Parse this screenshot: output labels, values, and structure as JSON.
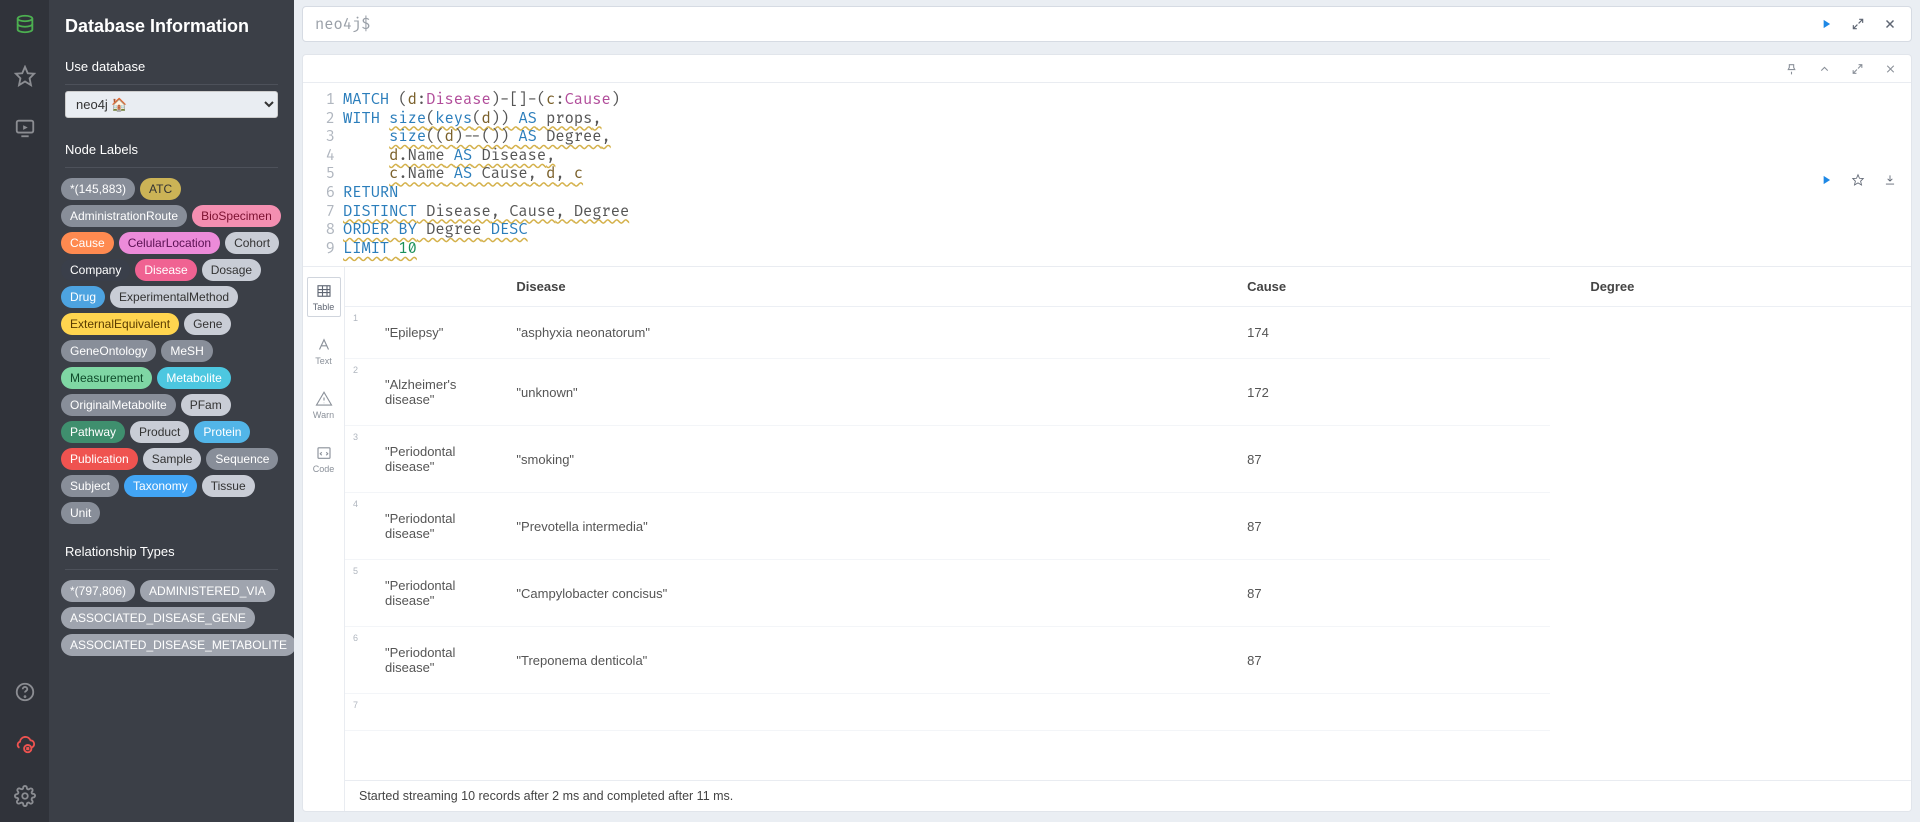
{
  "sidebar": {
    "title": "Database Information",
    "useDbHeading": "Use database",
    "dbSelected": "neo4j 🏠",
    "nodeLabelsHeading": "Node Labels",
    "labels": [
      {
        "text": "*(145,883)",
        "bg": "#888e99"
      },
      {
        "text": "ATC",
        "bg": "#cbb356",
        "fg": "#333"
      },
      {
        "text": "AdministrationRoute",
        "bg": "#888e99"
      },
      {
        "text": "BioSpecimen",
        "bg": "#f48fb1",
        "fg": "#7b1030"
      },
      {
        "text": "Cause",
        "bg": "#ff8a50"
      },
      {
        "text": "CelularLocation",
        "bg": "#ec8bd9",
        "fg": "#5a1052"
      },
      {
        "text": "Cohort",
        "bg": "#c9cdd6",
        "fg": "#333"
      },
      {
        "text": "Company",
        "bg": "#3a3f4a"
      },
      {
        "text": "Disease",
        "bg": "#f06292"
      },
      {
        "text": "Dosage",
        "bg": "#c9cdd6",
        "fg": "#333"
      },
      {
        "text": "Drug",
        "bg": "#4da3e0"
      },
      {
        "text": "ExperimentalMethod",
        "bg": "#c9cdd6",
        "fg": "#333"
      },
      {
        "text": "ExternalEquivalent",
        "bg": "#ffd54f",
        "fg": "#5a3b00"
      },
      {
        "text": "Gene",
        "bg": "#c9cdd6",
        "fg": "#333"
      },
      {
        "text": "GeneOntology",
        "bg": "#888e99"
      },
      {
        "text": "MeSH",
        "bg": "#888e99"
      },
      {
        "text": "Measurement",
        "bg": "#7fd7a4",
        "fg": "#0e4a2a"
      },
      {
        "text": "Metabolite",
        "bg": "#4dc7e0"
      },
      {
        "text": "OriginalMetabolite",
        "bg": "#888e99"
      },
      {
        "text": "PFam",
        "bg": "#c9cdd6",
        "fg": "#333"
      },
      {
        "text": "Pathway",
        "bg": "#3f8f6e"
      },
      {
        "text": "Product",
        "bg": "#c9cdd6",
        "fg": "#333"
      },
      {
        "text": "Protein",
        "bg": "#52b5e8"
      },
      {
        "text": "Publication",
        "bg": "#ef5350"
      },
      {
        "text": "Sample",
        "bg": "#c9cdd6",
        "fg": "#333"
      },
      {
        "text": "Sequence",
        "bg": "#888e99"
      },
      {
        "text": "Subject",
        "bg": "#888e99"
      },
      {
        "text": "Taxonomy",
        "bg": "#42a5f5"
      },
      {
        "text": "Tissue",
        "bg": "#c9cdd6",
        "fg": "#333"
      },
      {
        "text": "Unit",
        "bg": "#888e99"
      }
    ],
    "relHeading": "Relationship Types",
    "relTypes": [
      "*(797,806)",
      "ADMINISTERED_VIA",
      "ASSOCIATED_DISEASE_GENE",
      "ASSOCIATED_DISEASE_METABOLITE"
    ]
  },
  "prompt": {
    "text": "neo4j$"
  },
  "query": {
    "lines": [
      {
        "html": "<span class='kw'>MATCH</span> <span class='punct'>(</span><span class='var'>d</span><span class='punct'>:</span><span class='label-tok'>Disease</span><span class='punct'>)-[]-(</span><span class='var'>c</span><span class='punct'>:</span><span class='label-tok'>Cause</span><span class='punct'>)</span>"
      },
      {
        "html": "<span class='kw'>WITH</span> <span class='underline-warn'><span class='func'>size</span><span class='punct'>(</span><span class='func'>keys</span><span class='punct'>(</span><span class='var'>d</span><span class='punct'>))</span> <span class='kw'>AS</span> <span class='plain'>props</span><span class='punct'>,</span></span>"
      },
      {
        "html": "     <span class='underline-warn'><span class='func'>size</span><span class='punct'>((</span><span class='var'>d</span><span class='punct'>)--())</span> <span class='kw'>AS</span> <span class='plain'>Degree</span><span class='punct'>,</span></span>"
      },
      {
        "html": "     <span class='underline-warn'><span class='var'>d</span><span class='punct'>.</span><span class='plain'>Name</span> <span class='kw'>AS</span> <span class='plain'>Disease</span><span class='punct'>,</span></span>"
      },
      {
        "html": "     <span class='underline-warn'><span class='var'>c</span><span class='punct'>.</span><span class='plain'>Name</span> <span class='kw'>AS</span> <span class='plain'>Cause</span><span class='punct'>,</span> <span class='var'>d</span><span class='punct'>,</span> <span class='var'>c</span></span>"
      },
      {
        "html": "<span class='kw'>RETURN</span>"
      },
      {
        "html": "<span class='underline-warn'><span class='kw'>DISTINCT</span> <span class='plain'>Disease</span><span class='punct'>,</span> <span class='plain'>Cause</span><span class='punct'>,</span> <span class='plain'>Degree</span></span>"
      },
      {
        "html": "<span class='underline-warn'><span class='kw'>ORDER BY</span> <span class='plain'>Degree</span> <span class='kw'>DESC</span></span>"
      },
      {
        "html": "<span class='underline-warn'><span class='kw'>LIMIT</span> <span class='num'>10</span></span>"
      }
    ]
  },
  "viewtabs": {
    "table": "Table",
    "text": "Text",
    "warn": "Warn",
    "code": "Code"
  },
  "table": {
    "headers": [
      "Disease",
      "Cause",
      "Degree"
    ],
    "rows": [
      [
        "\"Epilepsy\"",
        "\"asphyxia neonatorum\"",
        "174"
      ],
      [
        "\"Alzheimer's disease\"",
        "\"unknown\"",
        "172"
      ],
      [
        "\"Periodontal disease\"",
        "\"smoking\"",
        "87"
      ],
      [
        "\"Periodontal disease\"",
        "\"Prevotella intermedia\"",
        "87"
      ],
      [
        "\"Periodontal disease\"",
        "\"Campylobacter concisus\"",
        "87"
      ],
      [
        "\"Periodontal disease\"",
        "\"Treponema denticola\"",
        "87"
      ]
    ]
  },
  "status": "Started streaming 10 records after 2 ms and completed after 11 ms."
}
